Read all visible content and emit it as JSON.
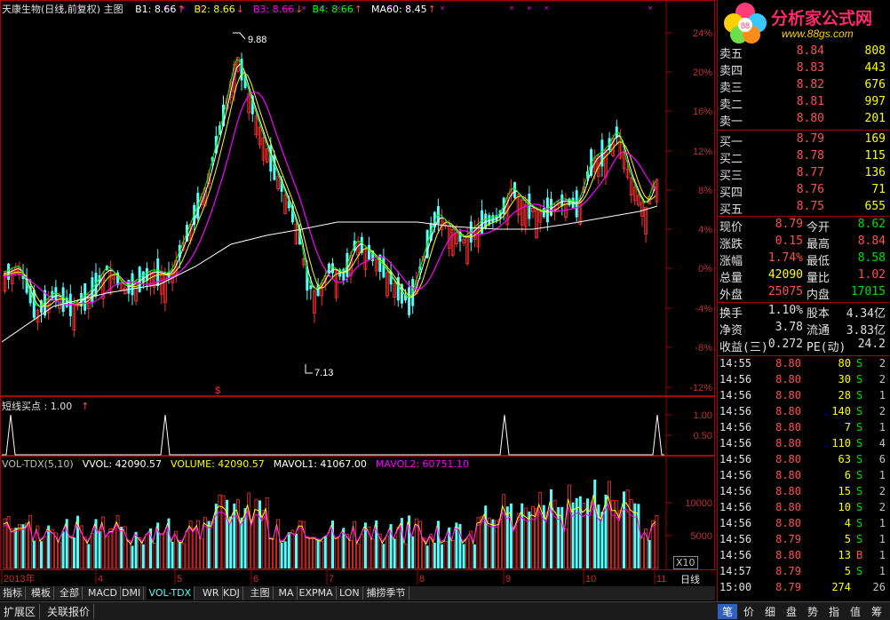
{
  "main_chart": {
    "title": "天康生物(日线,前复权) 主图",
    "legend": [
      {
        "text": "B1: 8.66",
        "color": "#ffffff",
        "arrow": "↑"
      },
      {
        "text": "B2: 8.66",
        "color": "#ffff00",
        "arrow": "↓"
      },
      {
        "text": "B3: 8.66",
        "color": "#ff00ff",
        "arrow": "↓"
      },
      {
        "text": "B4: 8.66",
        "color": "#00ff00",
        "arrow": "↑"
      },
      {
        "text": "MA60: 8.45",
        "color": "#ffffff",
        "arrow": "↑"
      }
    ],
    "y_ticks": [
      "24%",
      "20%",
      "16%",
      "12%",
      "8%",
      "4%",
      "0%",
      "-4%",
      "-8%",
      "-12%"
    ],
    "high_label": "9.88",
    "low_label": "7.13",
    "signal_mark": "$"
  },
  "indicator1": {
    "legend": "短线买点 : 1.00",
    "y_ticks": [
      "1.00",
      "0.50"
    ]
  },
  "volume": {
    "legend": [
      {
        "text": "VOL-TDX(5,10)",
        "color": "#c0c0c0"
      },
      {
        "text": "VVOL: 42090.57",
        "color": "#ffffff"
      },
      {
        "text": "VOLUME: 42090.57",
        "color": "#ffff00"
      },
      {
        "text": "MAVOL1: 41067.00",
        "color": "#ffffff"
      },
      {
        "text": "MAVOL2: 60751.10",
        "color": "#ff00ff"
      }
    ],
    "y_ticks": [
      "10000",
      "5000"
    ],
    "unit": "X10"
  },
  "x_axis": {
    "labels": [
      "2013年",
      "4",
      "5",
      "6",
      "7",
      "8",
      "9",
      "10",
      "11"
    ],
    "period": "日线"
  },
  "tabs": [
    "指标",
    "模板",
    "全部",
    "MACD",
    "DMI",
    "VOL-TDX",
    "WR",
    "KDJ",
    "主图",
    "MA",
    "EXPMA",
    "LON",
    "捕捞季节"
  ],
  "active_tab": "VOL-TDX",
  "bottom_tabs": [
    "扩展区",
    "关联报价"
  ],
  "logo": {
    "title": "分析家公式网",
    "url": "www.88gs.com"
  },
  "sells": [
    {
      "label": "卖五",
      "price": "8.84",
      "vol": "808"
    },
    {
      "label": "卖四",
      "price": "8.83",
      "vol": "443"
    },
    {
      "label": "卖三",
      "price": "8.82",
      "vol": "676"
    },
    {
      "label": "卖二",
      "price": "8.81",
      "vol": "997"
    },
    {
      "label": "卖一",
      "price": "8.80",
      "vol": "201"
    }
  ],
  "buys": [
    {
      "label": "买一",
      "price": "8.79",
      "vol": "169"
    },
    {
      "label": "买二",
      "price": "8.78",
      "vol": "115"
    },
    {
      "label": "买三",
      "price": "8.77",
      "vol": "136"
    },
    {
      "label": "买四",
      "price": "8.76",
      "vol": "71"
    },
    {
      "label": "买五",
      "price": "8.75",
      "vol": "655"
    }
  ],
  "quote": [
    {
      "l1": "现价",
      "v1": "8.79",
      "c1": "red",
      "l2": "今开",
      "v2": "8.62",
      "c2": "green"
    },
    {
      "l1": "涨跌",
      "v1": "0.15",
      "c1": "red",
      "l2": "最高",
      "v2": "8.84",
      "c2": "red"
    },
    {
      "l1": "涨幅",
      "v1": "1.74%",
      "c1": "red",
      "l2": "最低",
      "v2": "8.58",
      "c2": "green"
    },
    {
      "l1": "总量",
      "v1": "42090",
      "c1": "yellow",
      "l2": "量比",
      "v2": "1.02",
      "c2": "red"
    },
    {
      "l1": "外盘",
      "v1": "25075",
      "c1": "red",
      "l2": "内盘",
      "v2": "17015",
      "c2": "green"
    }
  ],
  "finance": [
    {
      "l1": "换手",
      "v1": "1.10%",
      "l2": "股本",
      "v2": "4.34亿"
    },
    {
      "l1": "净资",
      "v1": "3.78",
      "l2": "流通",
      "v2": "3.83亿"
    },
    {
      "l1": "收益(三)",
      "v1": "0.272",
      "l2": "PE(动)",
      "v2": "24.2"
    }
  ],
  "ticks": [
    {
      "t": "14:55",
      "p": "8.80",
      "v": "80",
      "s": "S",
      "n": "2"
    },
    {
      "t": "14:56",
      "p": "8.80",
      "v": "30",
      "s": "S",
      "n": "2"
    },
    {
      "t": "14:56",
      "p": "8.80",
      "v": "28",
      "s": "S",
      "n": "1"
    },
    {
      "t": "14:56",
      "p": "8.80",
      "v": "140",
      "s": "S",
      "n": "2"
    },
    {
      "t": "14:56",
      "p": "8.80",
      "v": "7",
      "s": "S",
      "n": "1"
    },
    {
      "t": "14:56",
      "p": "8.80",
      "v": "110",
      "s": "S",
      "n": "4"
    },
    {
      "t": "14:56",
      "p": "8.80",
      "v": "63",
      "s": "S",
      "n": "6"
    },
    {
      "t": "14:56",
      "p": "8.80",
      "v": "6",
      "s": "S",
      "n": "1"
    },
    {
      "t": "14:56",
      "p": "8.80",
      "v": "15",
      "s": "S",
      "n": "2"
    },
    {
      "t": "14:56",
      "p": "8.80",
      "v": "10",
      "s": "S",
      "n": "2"
    },
    {
      "t": "14:56",
      "p": "8.80",
      "v": "4",
      "s": "S",
      "n": "1"
    },
    {
      "t": "14:56",
      "p": "8.79",
      "v": "5",
      "s": "S",
      "n": "1"
    },
    {
      "t": "14:56",
      "p": "8.80",
      "v": "13",
      "s": "B",
      "n": "1"
    },
    {
      "t": "14:57",
      "p": "8.79",
      "v": "5",
      "s": "S",
      "n": "1"
    },
    {
      "t": "15:00",
      "p": "8.79",
      "v": "274",
      "s": "",
      "n": "26"
    }
  ],
  "right_tabs": [
    "笔",
    "价",
    "细",
    "盘",
    "势",
    "指",
    "值",
    "筹"
  ],
  "colors": {
    "up": "#ff3030",
    "down": "#54ffff",
    "ma_white": "#ffffff",
    "ma_yellow": "#ffff00",
    "ma_magenta": "#ff00ff",
    "ma_green": "#00ff00",
    "frame": "#aa0000"
  }
}
